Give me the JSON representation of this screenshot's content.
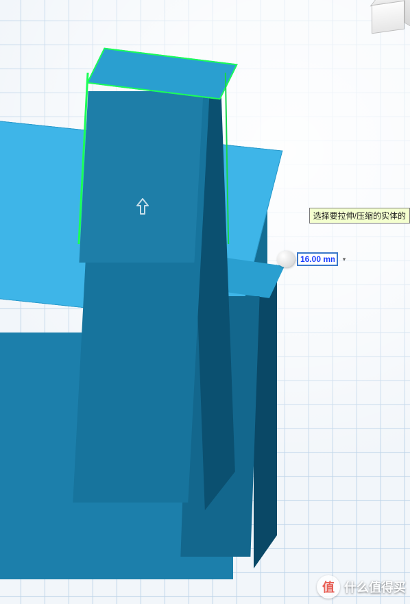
{
  "tooltip": {
    "text": "选择要拉伸/压缩的实体的"
  },
  "dimension": {
    "value": "16.00 mm"
  },
  "watermark": {
    "badge": "值",
    "text": "什么值得买"
  },
  "icons": {
    "arrow": "arrow-up",
    "dropdown": "▾"
  }
}
